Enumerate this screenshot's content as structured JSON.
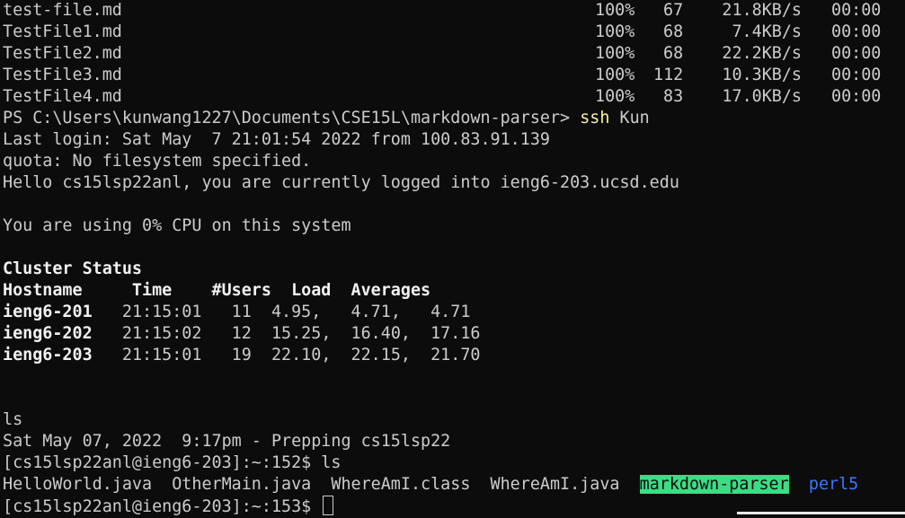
{
  "transfers": [
    {
      "file": "test-file.md",
      "pct": "100%",
      "n": "67",
      "rate": "21.8KB/s",
      "time": "00:00"
    },
    {
      "file": "TestFile1.md",
      "pct": "100%",
      "n": "68",
      "rate": "7.4KB/s",
      "time": "00:00"
    },
    {
      "file": "TestFile2.md",
      "pct": "100%",
      "n": "68",
      "rate": "22.2KB/s",
      "time": "00:00"
    },
    {
      "file": "TestFile3.md",
      "pct": "100%",
      "n": "112",
      "rate": "10.3KB/s",
      "time": "00:00"
    },
    {
      "file": "TestFile4.md",
      "pct": "100%",
      "n": "83",
      "rate": "17.0KB/s",
      "time": "00:00"
    }
  ],
  "ps_prompt": "PS C:\\Users\\kunwang1227\\Documents\\CSE15L\\markdown-parser>",
  "ps_cmd": "ssh",
  "ps_arg": "Kun",
  "last_login": "Last login: Sat May  7 21:01:54 2022 from 100.83.91.139",
  "quota": "quota: No filesystem specified.",
  "hello": "Hello cs15lsp22anl, you are currently logged into ieng6-203.ucsd.edu",
  "cpu": "You are using 0% CPU on this system",
  "cluster_title": "Cluster Status",
  "cluster_header": "Hostname     Time    #Users  Load  Averages",
  "cluster_rows": [
    {
      "host": "ieng6-201",
      "rest": "21:15:01   11  4.95,   4.71,   4.71"
    },
    {
      "host": "ieng6-202",
      "rest": "21:15:02   12  15.25,  16.40,  17.16"
    },
    {
      "host": "ieng6-203",
      "rest": "21:15:01   19  22.10,  22.15,  21.70"
    }
  ],
  "ls_echo": "ls",
  "prep": "Sat May 07, 2022  9:17pm - Prepping cs15lsp22",
  "prompt1": "[cs15lsp22anl@ieng6-203]:~:152$ ls",
  "ls_files": "HelloWorld.java  OtherMain.java  WhereAmI.class  WhereAmI.java  ",
  "ls_dir1": "markdown-parser",
  "ls_dir2": "perl5",
  "prompt2": "[cs15lsp22anl@ieng6-203]:~:153$ ",
  "colors": {
    "background": "#0c0c0c",
    "foreground": "#cccccc",
    "command_yellow": "#f9f1a5",
    "dir_highlight": "#3ddc84",
    "dir_blue": "#3b78ff"
  }
}
